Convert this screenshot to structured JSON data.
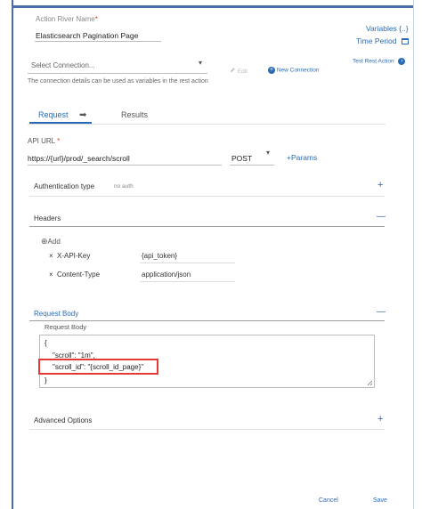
{
  "header": {
    "river_name_label": "Action River Name",
    "river_name_value": "Elasticsearch Pagination Page",
    "variables_label": "Variables",
    "variables_icon": "{..}",
    "time_period_label": "Time Period"
  },
  "connection": {
    "select_placeholder": "Select Connection...",
    "edit_label": "Edit",
    "new_connection_label": "New Connection",
    "test_label": "Test Rest Action",
    "helper_text": "The connection details can be used as variables in the rest action"
  },
  "tabs": {
    "request": "Request",
    "results": "Results"
  },
  "api": {
    "label": "API URL",
    "url": "https://{url}/prod/_search/scroll",
    "method": "POST",
    "params_label": "+Params"
  },
  "auth": {
    "label": "Authentication type",
    "value": "no auth"
  },
  "headers": {
    "title": "Headers",
    "add_label": "Add",
    "rows": [
      {
        "key": "X-API-Key",
        "value": "{api_token}"
      },
      {
        "key": "Content-Type",
        "value": "application/json"
      }
    ]
  },
  "body": {
    "title": "Request Body",
    "field_label": "Request Body",
    "lines": [
      "{",
      "\"scroll\": \"1m\",",
      "\"scroll_id\": \"{scroll_id_page}\"",
      "}"
    ]
  },
  "advanced": {
    "title": "Advanced Options"
  },
  "footer": {
    "cancel": "Cancel",
    "save": "Save"
  },
  "symbols": {
    "plus": "+",
    "minus": "—",
    "close": "×",
    "arrow_right": "➡",
    "caret": "▾",
    "asterisk": "*"
  },
  "colors": {
    "accent": "#2a6bb5",
    "highlight": "#e53935"
  }
}
